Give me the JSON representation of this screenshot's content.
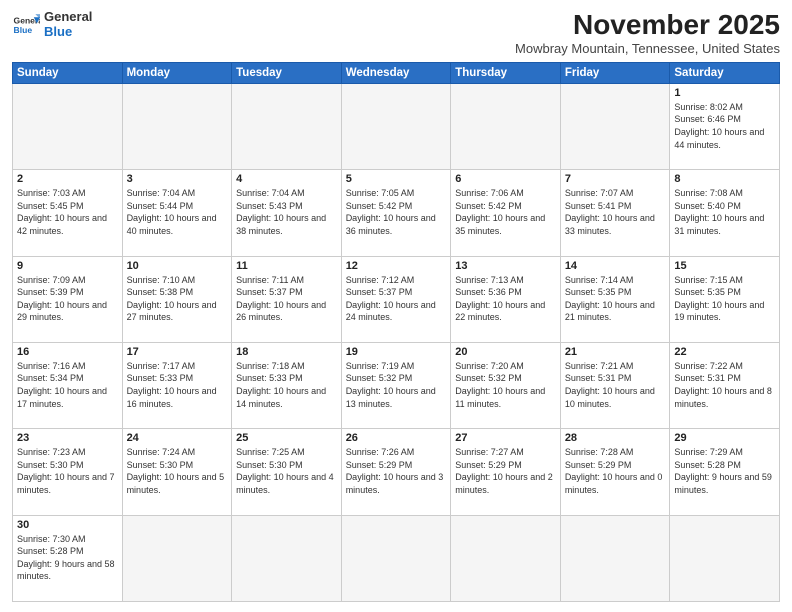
{
  "header": {
    "logo_general": "General",
    "logo_blue": "Blue",
    "month": "November 2025",
    "location": "Mowbray Mountain, Tennessee, United States"
  },
  "weekdays": [
    "Sunday",
    "Monday",
    "Tuesday",
    "Wednesday",
    "Thursday",
    "Friday",
    "Saturday"
  ],
  "weeks": [
    [
      {
        "day": "",
        "info": ""
      },
      {
        "day": "",
        "info": ""
      },
      {
        "day": "",
        "info": ""
      },
      {
        "day": "",
        "info": ""
      },
      {
        "day": "",
        "info": ""
      },
      {
        "day": "",
        "info": ""
      },
      {
        "day": "1",
        "info": "Sunrise: 8:02 AM\nSunset: 6:46 PM\nDaylight: 10 hours and 44 minutes."
      }
    ],
    [
      {
        "day": "2",
        "info": "Sunrise: 7:03 AM\nSunset: 5:45 PM\nDaylight: 10 hours and 42 minutes."
      },
      {
        "day": "3",
        "info": "Sunrise: 7:04 AM\nSunset: 5:44 PM\nDaylight: 10 hours and 40 minutes."
      },
      {
        "day": "4",
        "info": "Sunrise: 7:04 AM\nSunset: 5:43 PM\nDaylight: 10 hours and 38 minutes."
      },
      {
        "day": "5",
        "info": "Sunrise: 7:05 AM\nSunset: 5:42 PM\nDaylight: 10 hours and 36 minutes."
      },
      {
        "day": "6",
        "info": "Sunrise: 7:06 AM\nSunset: 5:42 PM\nDaylight: 10 hours and 35 minutes."
      },
      {
        "day": "7",
        "info": "Sunrise: 7:07 AM\nSunset: 5:41 PM\nDaylight: 10 hours and 33 minutes."
      },
      {
        "day": "8",
        "info": "Sunrise: 7:08 AM\nSunset: 5:40 PM\nDaylight: 10 hours and 31 minutes."
      }
    ],
    [
      {
        "day": "9",
        "info": "Sunrise: 7:09 AM\nSunset: 5:39 PM\nDaylight: 10 hours and 29 minutes."
      },
      {
        "day": "10",
        "info": "Sunrise: 7:10 AM\nSunset: 5:38 PM\nDaylight: 10 hours and 27 minutes."
      },
      {
        "day": "11",
        "info": "Sunrise: 7:11 AM\nSunset: 5:37 PM\nDaylight: 10 hours and 26 minutes."
      },
      {
        "day": "12",
        "info": "Sunrise: 7:12 AM\nSunset: 5:37 PM\nDaylight: 10 hours and 24 minutes."
      },
      {
        "day": "13",
        "info": "Sunrise: 7:13 AM\nSunset: 5:36 PM\nDaylight: 10 hours and 22 minutes."
      },
      {
        "day": "14",
        "info": "Sunrise: 7:14 AM\nSunset: 5:35 PM\nDaylight: 10 hours and 21 minutes."
      },
      {
        "day": "15",
        "info": "Sunrise: 7:15 AM\nSunset: 5:35 PM\nDaylight: 10 hours and 19 minutes."
      }
    ],
    [
      {
        "day": "16",
        "info": "Sunrise: 7:16 AM\nSunset: 5:34 PM\nDaylight: 10 hours and 17 minutes."
      },
      {
        "day": "17",
        "info": "Sunrise: 7:17 AM\nSunset: 5:33 PM\nDaylight: 10 hours and 16 minutes."
      },
      {
        "day": "18",
        "info": "Sunrise: 7:18 AM\nSunset: 5:33 PM\nDaylight: 10 hours and 14 minutes."
      },
      {
        "day": "19",
        "info": "Sunrise: 7:19 AM\nSunset: 5:32 PM\nDaylight: 10 hours and 13 minutes."
      },
      {
        "day": "20",
        "info": "Sunrise: 7:20 AM\nSunset: 5:32 PM\nDaylight: 10 hours and 11 minutes."
      },
      {
        "day": "21",
        "info": "Sunrise: 7:21 AM\nSunset: 5:31 PM\nDaylight: 10 hours and 10 minutes."
      },
      {
        "day": "22",
        "info": "Sunrise: 7:22 AM\nSunset: 5:31 PM\nDaylight: 10 hours and 8 minutes."
      }
    ],
    [
      {
        "day": "23",
        "info": "Sunrise: 7:23 AM\nSunset: 5:30 PM\nDaylight: 10 hours and 7 minutes."
      },
      {
        "day": "24",
        "info": "Sunrise: 7:24 AM\nSunset: 5:30 PM\nDaylight: 10 hours and 5 minutes."
      },
      {
        "day": "25",
        "info": "Sunrise: 7:25 AM\nSunset: 5:30 PM\nDaylight: 10 hours and 4 minutes."
      },
      {
        "day": "26",
        "info": "Sunrise: 7:26 AM\nSunset: 5:29 PM\nDaylight: 10 hours and 3 minutes."
      },
      {
        "day": "27",
        "info": "Sunrise: 7:27 AM\nSunset: 5:29 PM\nDaylight: 10 hours and 2 minutes."
      },
      {
        "day": "28",
        "info": "Sunrise: 7:28 AM\nSunset: 5:29 PM\nDaylight: 10 hours and 0 minutes."
      },
      {
        "day": "29",
        "info": "Sunrise: 7:29 AM\nSunset: 5:28 PM\nDaylight: 9 hours and 59 minutes."
      }
    ],
    [
      {
        "day": "30",
        "info": "Sunrise: 7:30 AM\nSunset: 5:28 PM\nDaylight: 9 hours and 58 minutes."
      },
      {
        "day": "",
        "info": ""
      },
      {
        "day": "",
        "info": ""
      },
      {
        "day": "",
        "info": ""
      },
      {
        "day": "",
        "info": ""
      },
      {
        "day": "",
        "info": ""
      },
      {
        "day": "",
        "info": ""
      }
    ]
  ]
}
